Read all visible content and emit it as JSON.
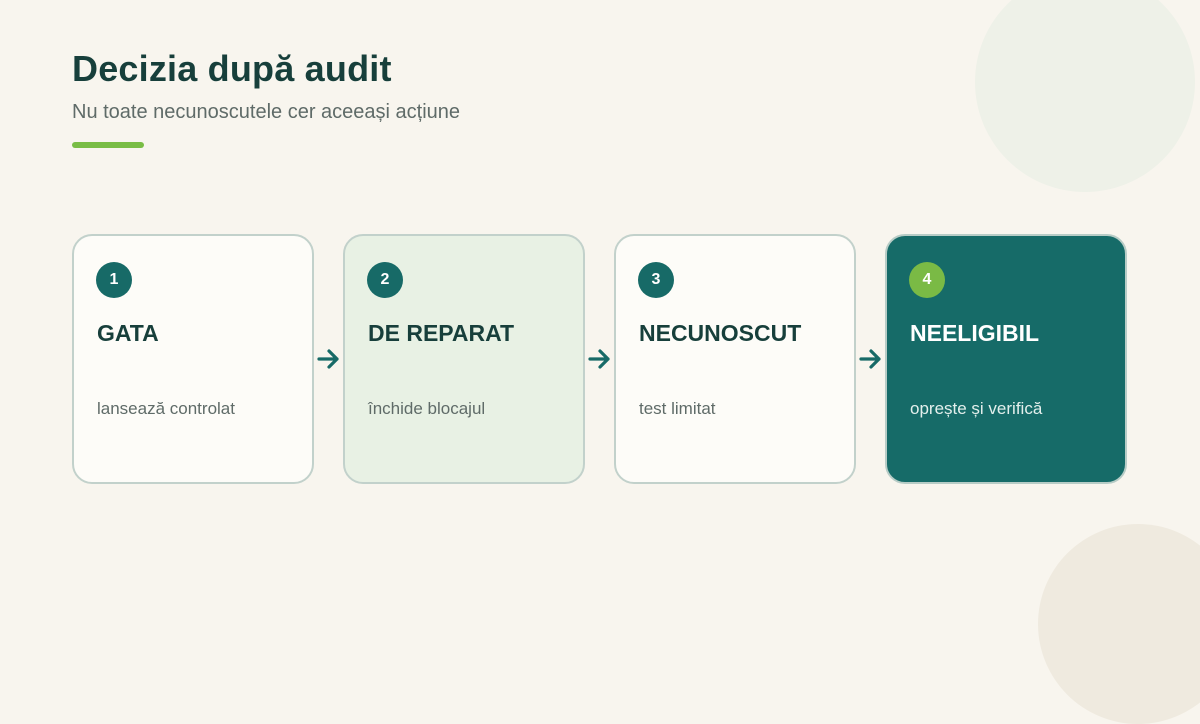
{
  "header": {
    "title": "Decizia după audit",
    "subtitle": "Nu toate necunoscutele cer aceeași acțiune"
  },
  "colors": {
    "background": "#f8f5ee",
    "primary": "#176a67",
    "accent": "#79bd45",
    "text_dark": "#173f3b",
    "text_muted": "#5f6b68"
  },
  "steps": [
    {
      "number": "1",
      "title": "GATA",
      "description": "lansează controlat"
    },
    {
      "number": "2",
      "title": "DE REPARAT",
      "description": "închide blocajul"
    },
    {
      "number": "3",
      "title": "NECUNOSCUT",
      "description": "test limitat"
    },
    {
      "number": "4",
      "title": "NEELIGIBIL",
      "description": "oprește și verifică"
    }
  ],
  "connector_icon": "arrow-right-icon"
}
